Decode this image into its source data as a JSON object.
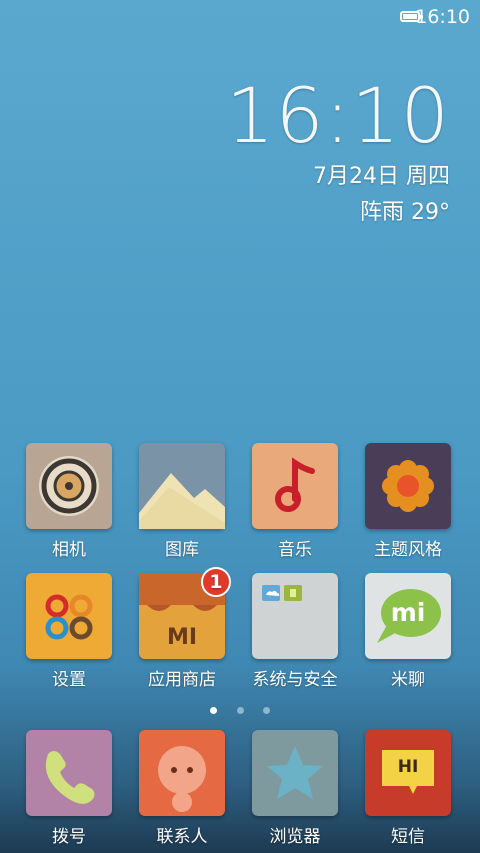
{
  "status_bar": {
    "time": "16:10",
    "battery_icon": "battery-icon"
  },
  "clock_widget": {
    "time": "16:10",
    "date": "7月24日 周四",
    "weather": "阵雨  29°"
  },
  "apps_row1": [
    {
      "label": "相机",
      "icon": "camera-icon"
    },
    {
      "label": "图库",
      "icon": "gallery-icon"
    },
    {
      "label": "音乐",
      "icon": "music-icon"
    },
    {
      "label": "主题风格",
      "icon": "theme-icon"
    }
  ],
  "apps_row2": [
    {
      "label": "设置",
      "icon": "settings-icon"
    },
    {
      "label": "应用商店",
      "icon": "app-store-icon",
      "badge": "1",
      "tile_text": "MI"
    },
    {
      "label": "系统与安全",
      "icon": "folder-icon"
    },
    {
      "label": "米聊",
      "icon": "miliao-icon",
      "tile_text": "mi"
    }
  ],
  "page_indicator": {
    "pages": 3,
    "active": 0
  },
  "dock": [
    {
      "label": "拨号",
      "icon": "phone-icon"
    },
    {
      "label": "联系人",
      "icon": "contacts-icon"
    },
    {
      "label": "浏览器",
      "icon": "browser-icon"
    },
    {
      "label": "短信",
      "icon": "messages-icon",
      "tile_text": "HI"
    }
  ]
}
